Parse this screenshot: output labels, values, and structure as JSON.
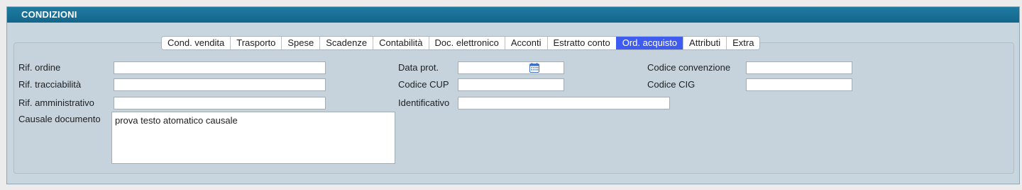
{
  "window": {
    "title": "CONDIZIONI"
  },
  "tabs": [
    {
      "label": "Cond. vendita",
      "active": false
    },
    {
      "label": "Trasporto",
      "active": false
    },
    {
      "label": "Spese",
      "active": false
    },
    {
      "label": "Scadenze",
      "active": false
    },
    {
      "label": "Contabilità",
      "active": false
    },
    {
      "label": "Doc. elettronico",
      "active": false
    },
    {
      "label": "Acconti",
      "active": false
    },
    {
      "label": "Estratto conto",
      "active": false
    },
    {
      "label": "Ord. acquisto",
      "active": true
    },
    {
      "label": "Attributi",
      "active": false
    },
    {
      "label": "Extra",
      "active": false
    }
  ],
  "form": {
    "rif_ordine": {
      "label": "Rif. ordine",
      "value": ""
    },
    "rif_tracciabilita": {
      "label": "Rif. tracciabilità",
      "value": ""
    },
    "rif_amministrativo": {
      "label": "Rif. amministrativo",
      "value": ""
    },
    "causale_documento": {
      "label": "Causale documento",
      "value": "prova testo atomatico causale"
    },
    "data_prot": {
      "label": "Data prot.",
      "value": ""
    },
    "codice_cup": {
      "label": "Codice CUP",
      "value": ""
    },
    "identificativo": {
      "label": "Identificativo",
      "value": ""
    },
    "codice_convenzione": {
      "label": "Codice convenzione",
      "value": ""
    },
    "codice_cig": {
      "label": "Codice CIG",
      "value": ""
    }
  },
  "colors": {
    "titlebar": "#1a719a",
    "active_tab": "#3f5cf1",
    "panel": "#c6d3dc"
  },
  "icons": {
    "date_picker": "calendar-icon"
  }
}
